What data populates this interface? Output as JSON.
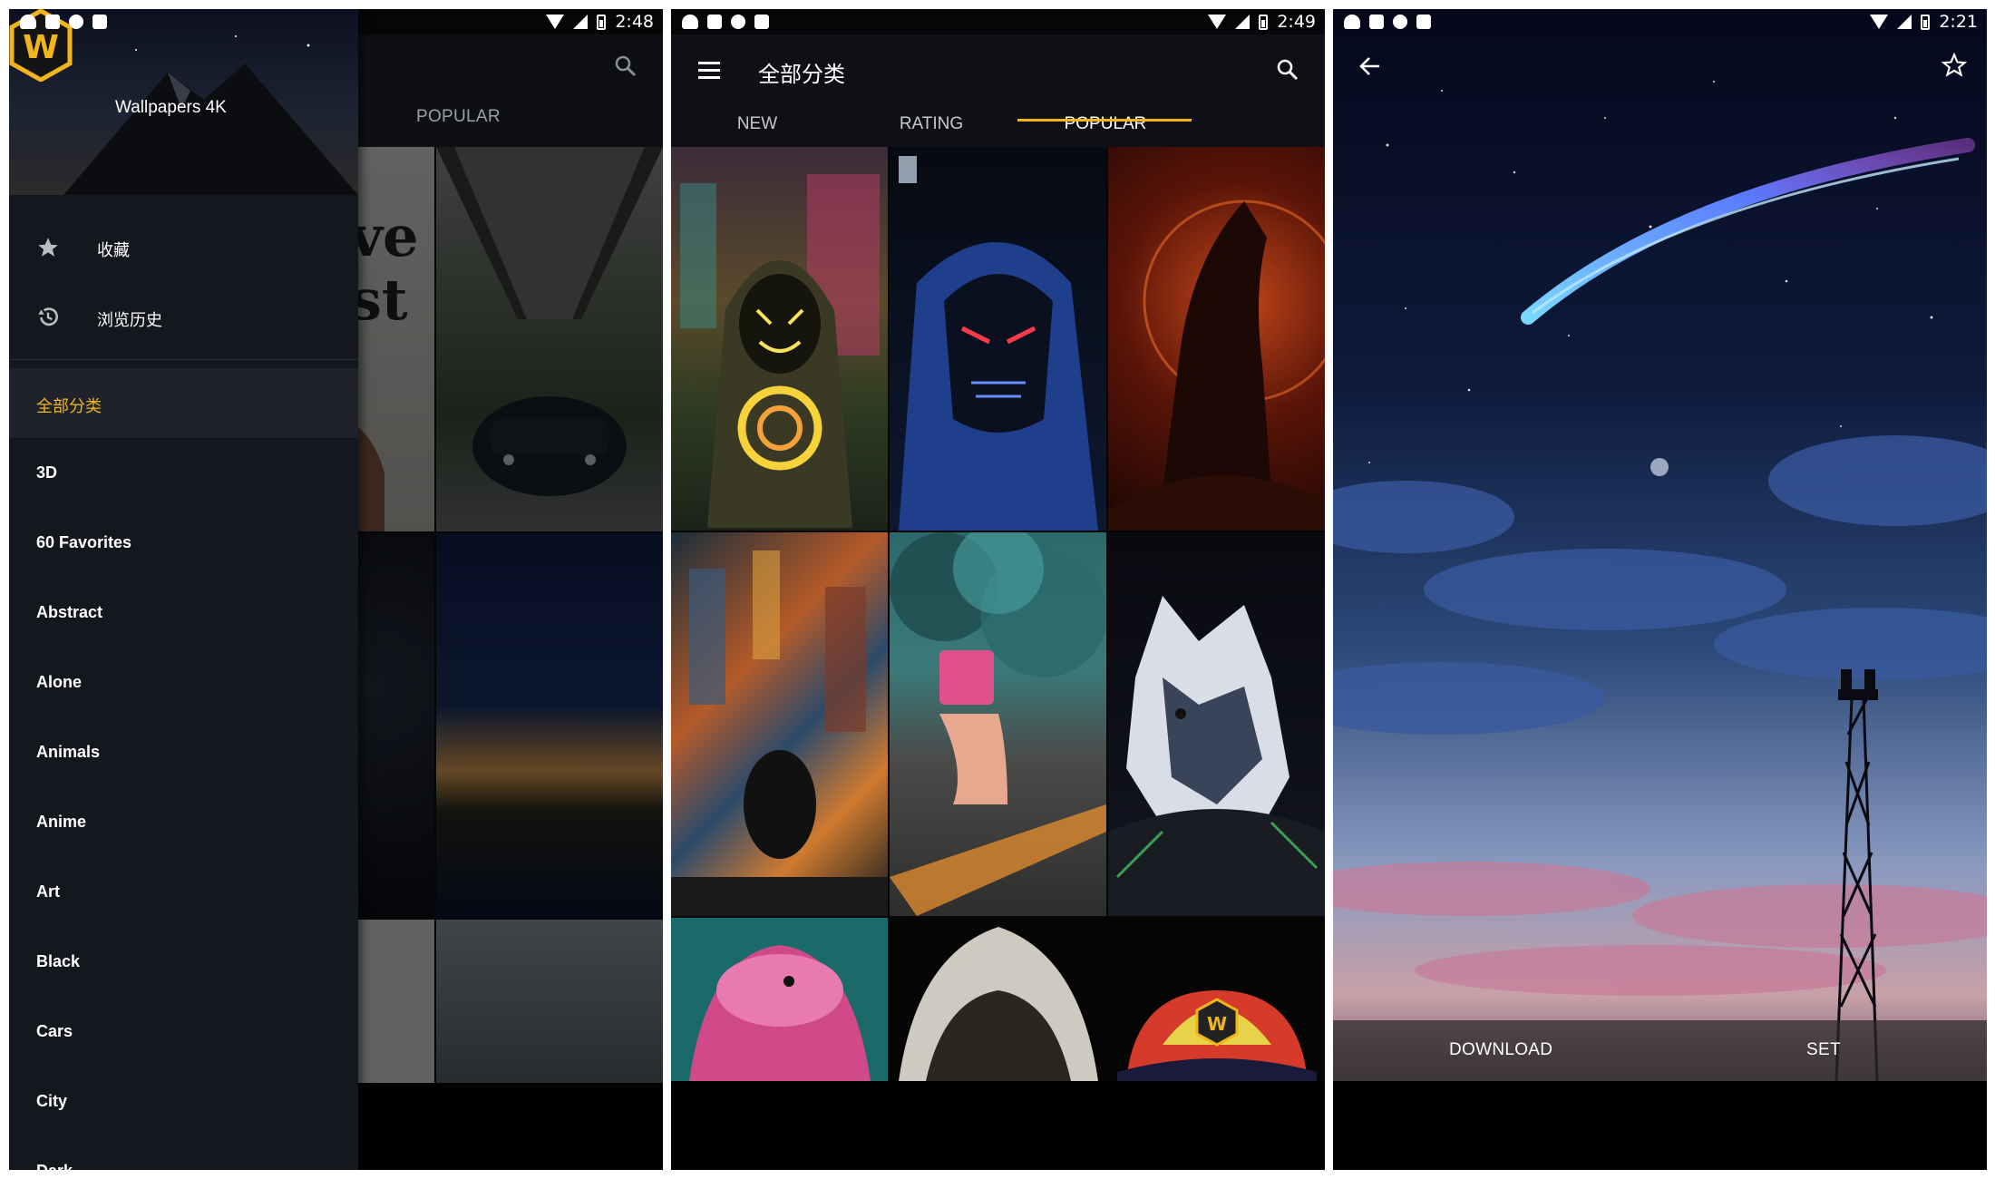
{
  "colors": {
    "accent": "#f1b51c",
    "background": "#050608",
    "drawer": "#14171d"
  },
  "phone1": {
    "status": {
      "time": "2:48"
    },
    "app_title": "Wallpapers 4K",
    "logo_letter": "W",
    "behind_tab": "POPULAR",
    "menu": [
      {
        "label": "收藏",
        "icon": "star-icon"
      },
      {
        "label": "浏览历史",
        "icon": "history-icon"
      }
    ],
    "categories": [
      "全部分类",
      "3D",
      "60 Favorites",
      "Abstract",
      "Alone",
      "Animals",
      "Anime",
      "Art",
      "Black",
      "Cars",
      "City",
      "Dark"
    ],
    "active_category": "全部分类"
  },
  "phone2": {
    "status": {
      "time": "2:49"
    },
    "title": "全部分类",
    "tabs": [
      {
        "label": "NEW"
      },
      {
        "label": "RATING"
      },
      {
        "label": "POPULAR"
      }
    ],
    "active_tab": "POPULAR",
    "tiles": [
      "hooded-neon-mask",
      "blue-hood-neon-mask",
      "howling-wolf",
      "city-rooftop",
      "smoke-mask-person",
      "husky-hoodie",
      "pink-axolotl-hat",
      "hooded-figure",
      "w-cap-character"
    ]
  },
  "phone3": {
    "status": {
      "time": "2:21"
    },
    "download_label": "DOWNLOAD",
    "set_label": "SET"
  }
}
